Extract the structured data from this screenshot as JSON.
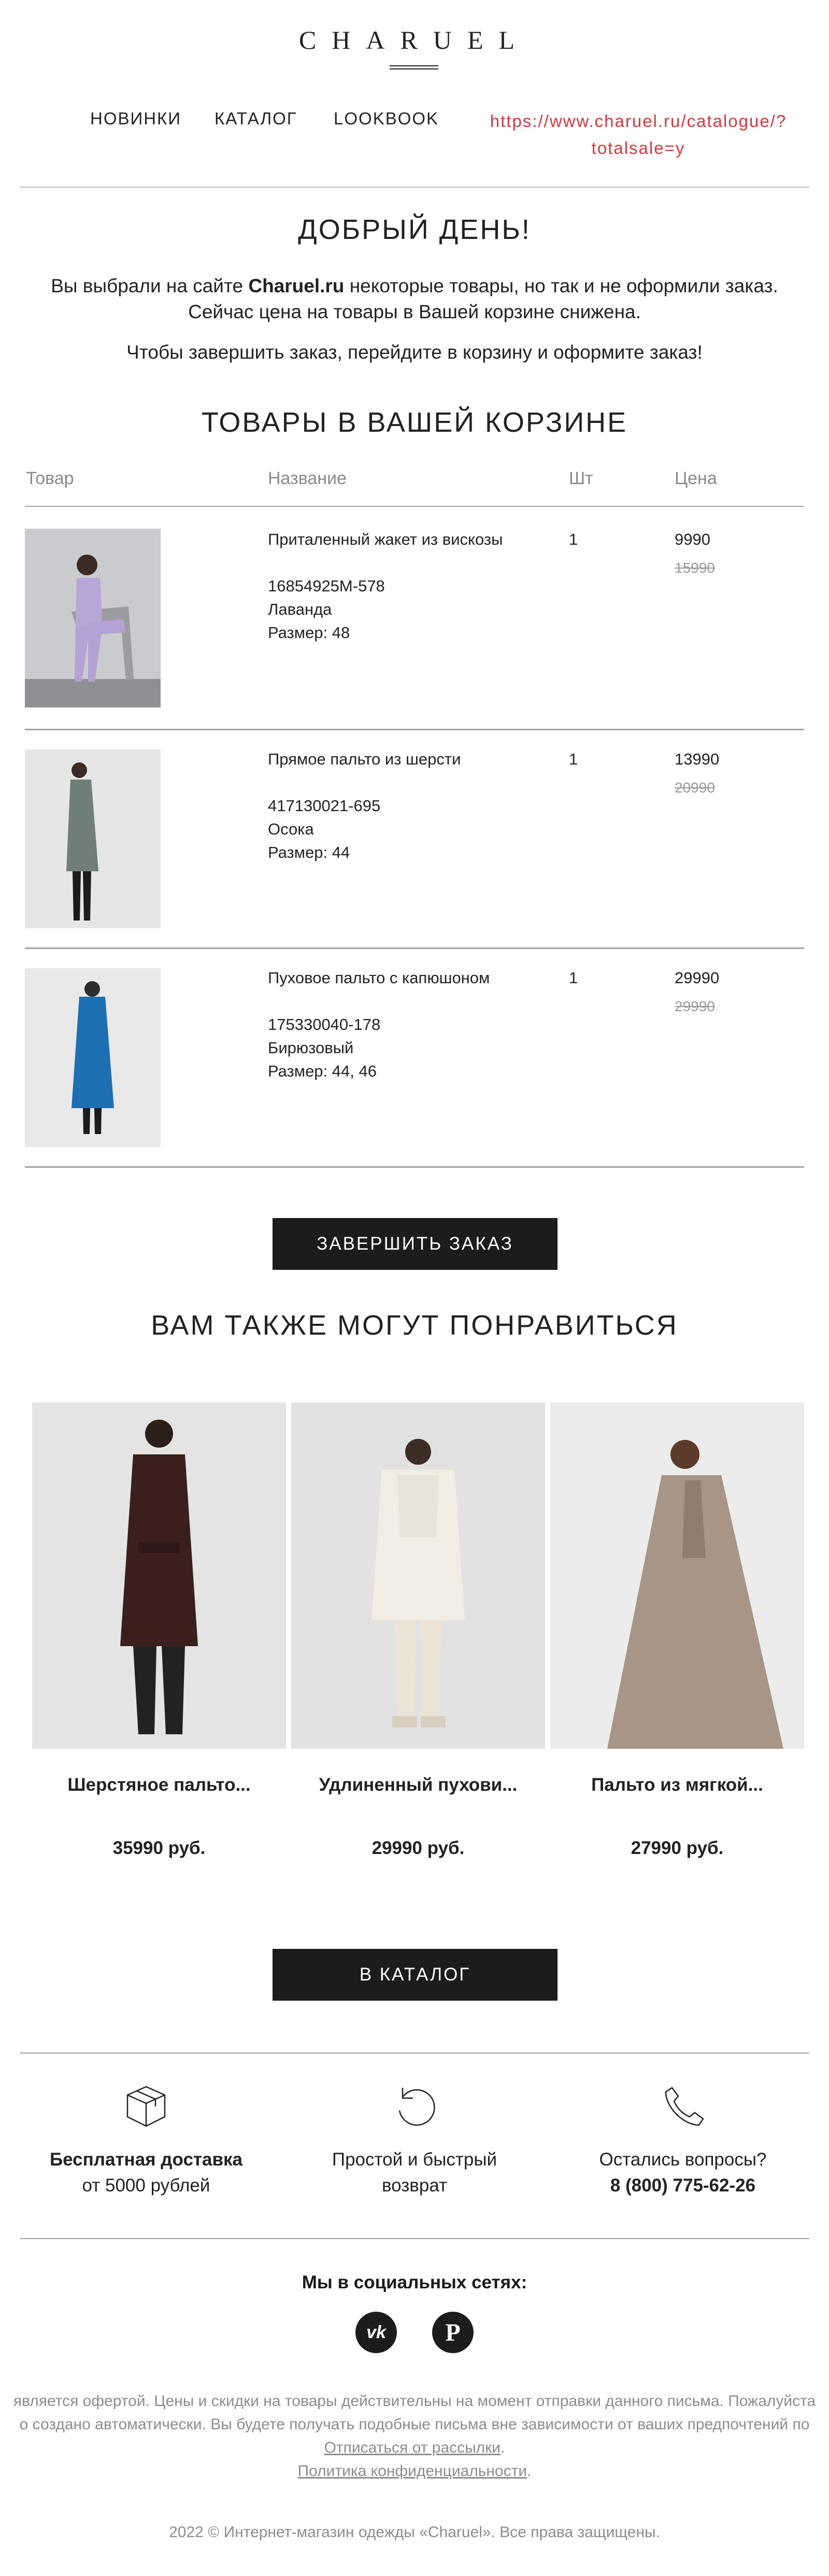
{
  "header": {
    "logo": "CHARUEL",
    "nav": [
      "НОВИНКИ",
      "КАТАЛОГ",
      "LOOKBOOK"
    ],
    "nav_link_line1": "https://www.charuel.ru/catalogue/?",
    "nav_link_line2": "totalsale=y"
  },
  "greeting": {
    "title": "ДОБРЫЙ ДЕНЬ!",
    "line1_pre": "Вы выбрали на сайте ",
    "line1_brand": "Charuel.ru",
    "line1_post": " некоторые товары, но так и не оформили заказ.",
    "line2": "Сейчас цена на товары в Вашей корзине снижена.",
    "line3": "Чтобы завершить заказ, перейдите в корзину и оформите заказ!"
  },
  "cart": {
    "title": "ТОВАРЫ В ВАШЕЙ КОРЗИНЕ",
    "headers": [
      "Товар",
      "Название",
      "Шт",
      "Цена"
    ],
    "items": [
      {
        "name": "Приталенный жакет из вискозы",
        "sku": "16854925M-578",
        "color": "Лаванда",
        "size": "Размер: 48",
        "qty": "1",
        "price": "9990",
        "old_price": "15990"
      },
      {
        "name": "Прямое пальто из шерсти",
        "sku": "417130021-695",
        "color": "Осока",
        "size": "Размер: 44",
        "qty": "1",
        "price": "13990",
        "old_price": "20990"
      },
      {
        "name": "Пуховое пальто с капюшоном",
        "sku": "175330040-178",
        "color": "Бирюзовый",
        "size": "Размер: 44, 46",
        "qty": "1",
        "price": "29990",
        "old_price": "29990"
      }
    ],
    "button": "ЗАВЕРШИТЬ ЗАКАЗ"
  },
  "recommend": {
    "title": "ВАМ ТАКЖЕ МОГУТ ПОНРАВИТЬСЯ",
    "items": [
      {
        "name": "Шерстяное пальто...",
        "price": "35990 руб."
      },
      {
        "name": "Удлиненный пухови...",
        "price": "29990 руб."
      },
      {
        "name": "Пальто из мягкой...",
        "price": "27990 руб."
      }
    ],
    "button": "В КАТАЛОГ"
  },
  "features": [
    {
      "icon": "box-icon",
      "line1": "Бесплатная доставка",
      "line2": "от 5000 рублей"
    },
    {
      "icon": "return-icon",
      "line1": "Простой и быстрый",
      "line2": "возврат"
    },
    {
      "icon": "phone-icon",
      "line1": "Остались вопросы?",
      "line2": "8 (800) 775-62-26"
    }
  ],
  "social": {
    "title": "Мы в социальных сетях:",
    "vk": "vk",
    "pinterest": "P"
  },
  "footer": {
    "disclaimer1": "является офертой. Цены и скидки на товары действительны на момент отправки данного письма. Пожалуйста",
    "disclaimer2": "о создано автоматически. Вы будете получать подобные письма вне зависимости от ваших предпочтений по",
    "unsubscribe": "Отписаться от рассылки",
    "privacy": "Политика конфиденциальности",
    "copyright": "2022 © Интернет-магазин одежды «Charuel». Все права защищены."
  }
}
